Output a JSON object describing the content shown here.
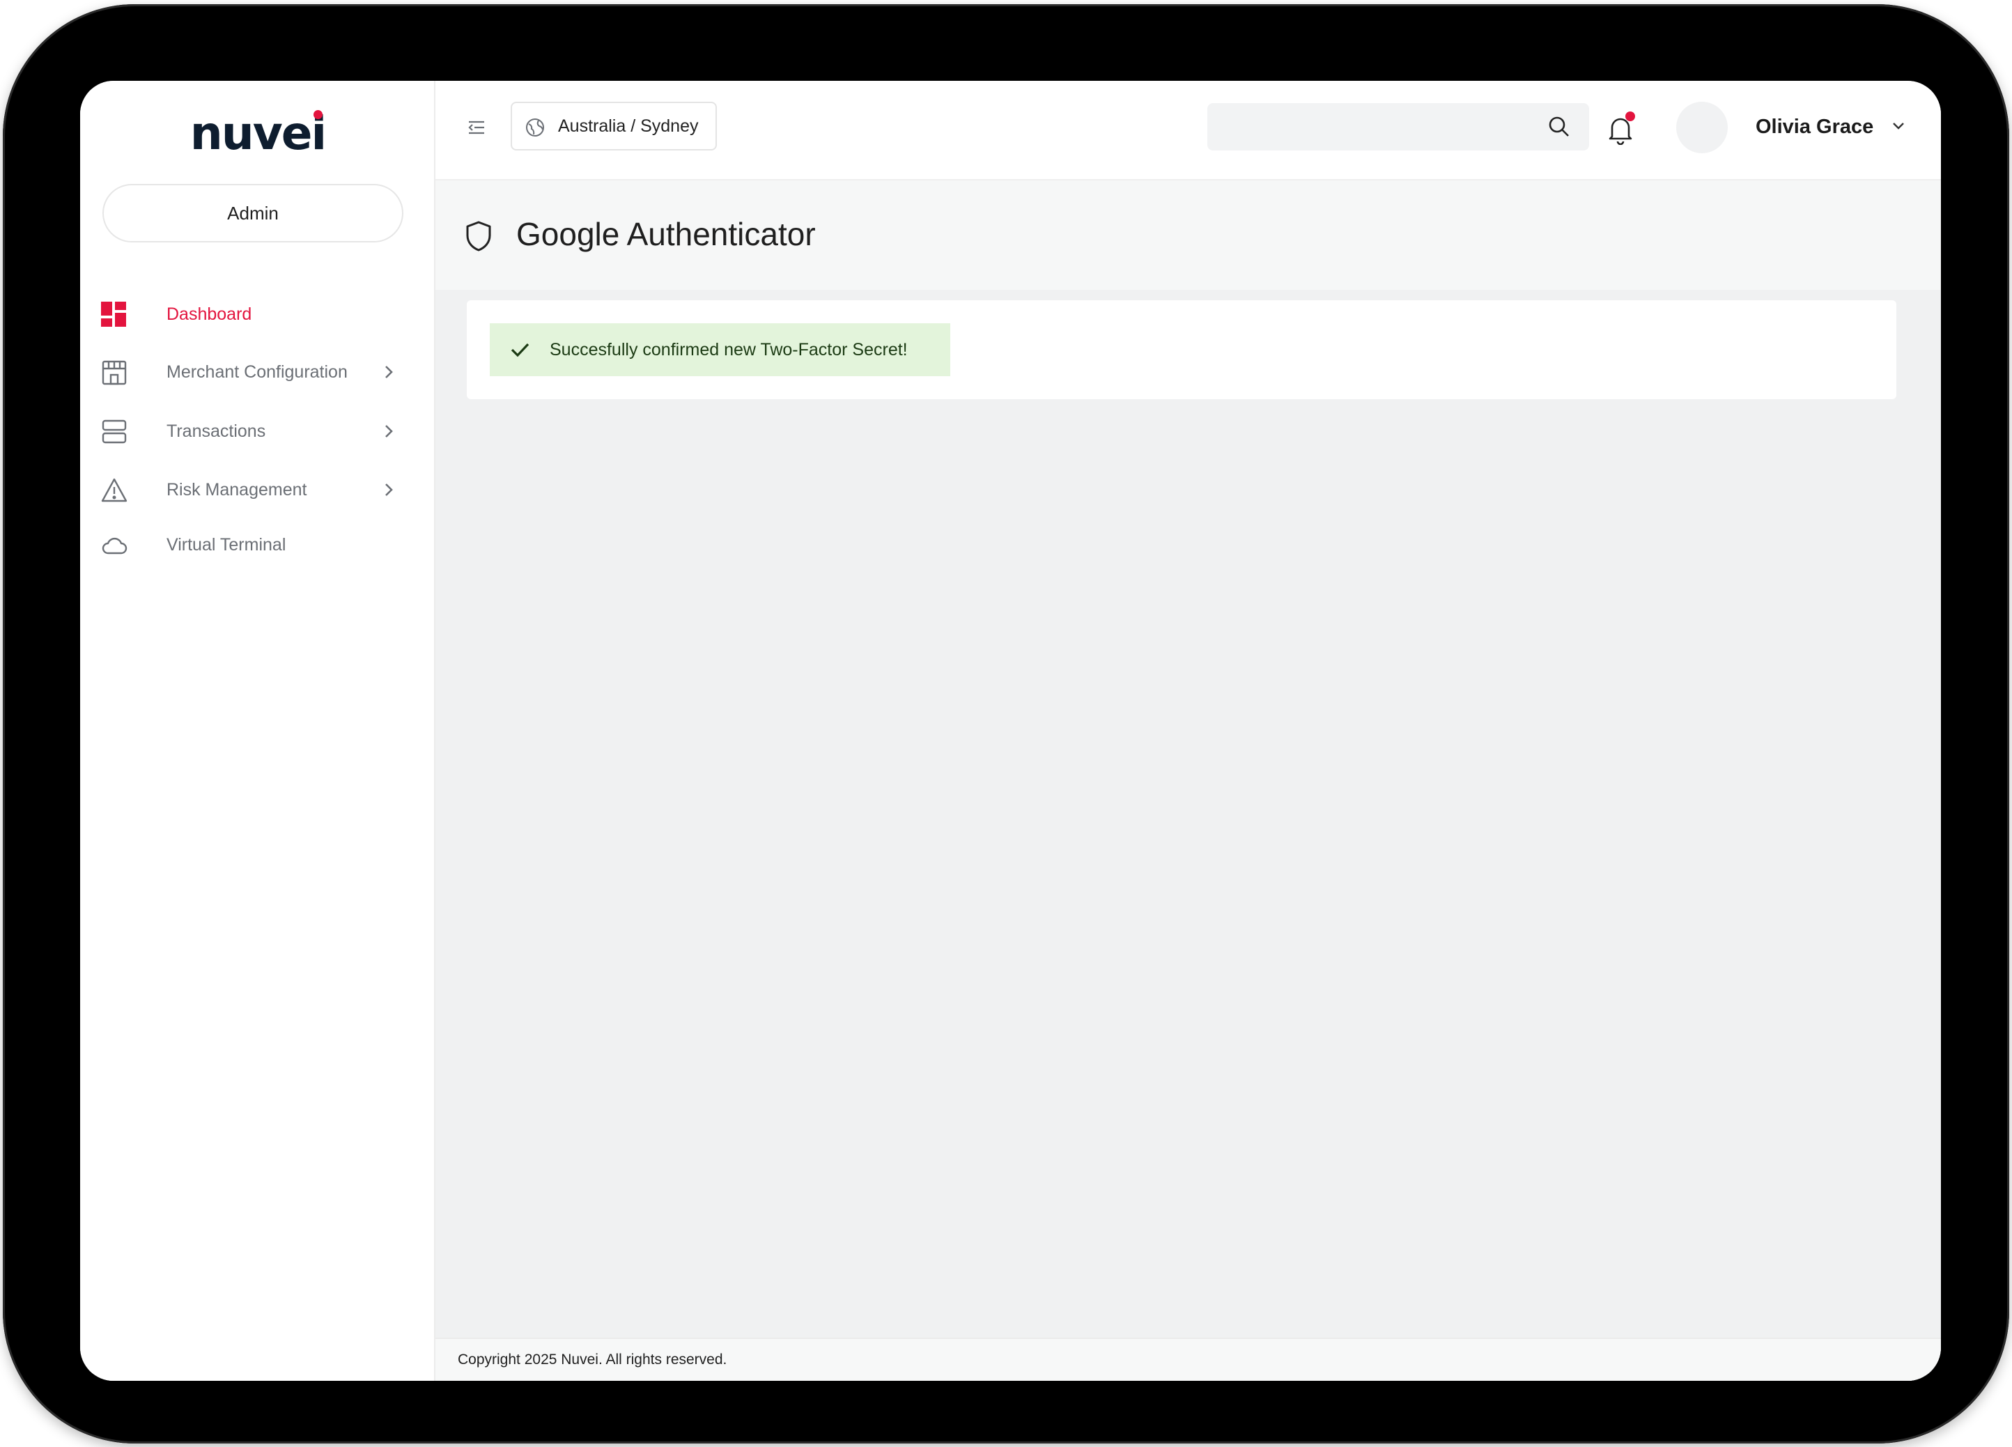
{
  "brand": {
    "logo_text": "nuvei",
    "accent_color": "#e3143e"
  },
  "sidebar": {
    "role_label": "Admin",
    "items": [
      {
        "label": "Dashboard",
        "icon": "dashboard-icon",
        "active": true,
        "has_submenu": false
      },
      {
        "label": "Merchant Configuration",
        "icon": "store-icon",
        "active": false,
        "has_submenu": true
      },
      {
        "label": "Transactions",
        "icon": "server-stack-icon",
        "active": false,
        "has_submenu": true
      },
      {
        "label": "Risk Management",
        "icon": "warning-icon",
        "active": false,
        "has_submenu": true
      },
      {
        "label": "Virtual Terminal",
        "icon": "cloud-icon",
        "active": false,
        "has_submenu": false
      }
    ]
  },
  "topbar": {
    "timezone_label": "Australia / Sydney",
    "search": {
      "value": "",
      "placeholder": ""
    },
    "notifications": {
      "has_unread": true
    },
    "user": {
      "name": "Olivia Grace"
    }
  },
  "page": {
    "title": "Google Authenticator",
    "alert": {
      "type": "success",
      "message": "Succesfully confirmed new Two-Factor Secret!"
    }
  },
  "footer": {
    "copyright": "Copyright 2025 Nuvei. All rights reserved."
  }
}
